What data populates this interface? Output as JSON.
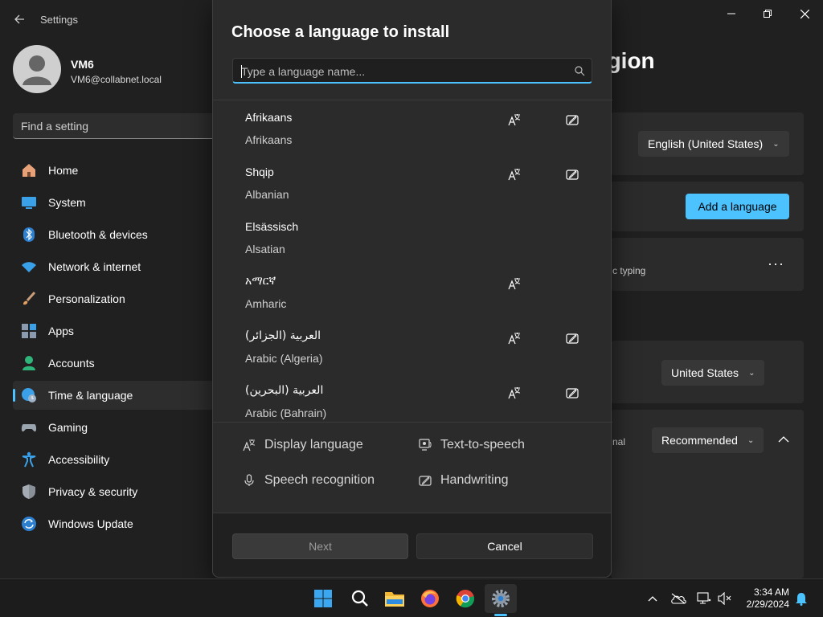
{
  "app": {
    "title": "Settings"
  },
  "profile": {
    "name": "VM6",
    "email": "VM6@collabnet.local"
  },
  "search": {
    "placeholder": "Find a setting"
  },
  "nav": [
    {
      "label": "Home",
      "icon": "home-icon"
    },
    {
      "label": "System",
      "icon": "system-icon"
    },
    {
      "label": "Bluetooth & devices",
      "icon": "bluetooth-icon"
    },
    {
      "label": "Network & internet",
      "icon": "wifi-icon"
    },
    {
      "label": "Personalization",
      "icon": "brush-icon"
    },
    {
      "label": "Apps",
      "icon": "apps-icon"
    },
    {
      "label": "Accounts",
      "icon": "accounts-icon"
    },
    {
      "label": "Time & language",
      "icon": "globe-clock-icon",
      "selected": true
    },
    {
      "label": "Gaming",
      "icon": "gamepad-icon"
    },
    {
      "label": "Accessibility",
      "icon": "accessibility-icon"
    },
    {
      "label": "Privacy & security",
      "icon": "shield-icon"
    },
    {
      "label": "Windows Update",
      "icon": "update-icon"
    }
  ],
  "background_page": {
    "title_fragment": "egion",
    "windows_display_language": "English (United States)",
    "add_language_button": "Add a language",
    "typing_fragment": "c typing",
    "country": "United States",
    "regional_fragment": "nal",
    "regional_format": "Recommended"
  },
  "dialog": {
    "title": "Choose a language to install",
    "search_placeholder": "Type a language name...",
    "languages": [
      {
        "native": "Afrikaans",
        "english": "Afrikaans",
        "display_language": true,
        "handwriting": true
      },
      {
        "native": "Shqip",
        "english": "Albanian",
        "display_language": true,
        "handwriting": true
      },
      {
        "native": "Elsässisch",
        "english": "Alsatian",
        "display_language": false,
        "handwriting": false
      },
      {
        "native": "አማርኛ",
        "english": "Amharic",
        "display_language": true,
        "handwriting": false
      },
      {
        "native": "العربية (الجزائر)",
        "english": "Arabic (Algeria)",
        "display_language": true,
        "handwriting": true
      },
      {
        "native": "العربية (البحرين)",
        "english": "Arabic (Bahrain)",
        "display_language": true,
        "handwriting": true
      }
    ],
    "legend": {
      "display_language": "Display language",
      "text_to_speech": "Text-to-speech",
      "speech_recognition": "Speech recognition",
      "handwriting": "Handwriting"
    },
    "next_button": "Next",
    "cancel_button": "Cancel"
  },
  "taskbar": {
    "apps": [
      "windows-start-icon",
      "search-icon",
      "file-explorer-icon",
      "firefox-icon",
      "chrome-icon",
      "settings-icon"
    ],
    "time": "3:34 AM",
    "date": "2/29/2024"
  },
  "colors": {
    "accent": "#4cc2ff",
    "background": "#202020",
    "dialog": "#2b2b2b"
  }
}
